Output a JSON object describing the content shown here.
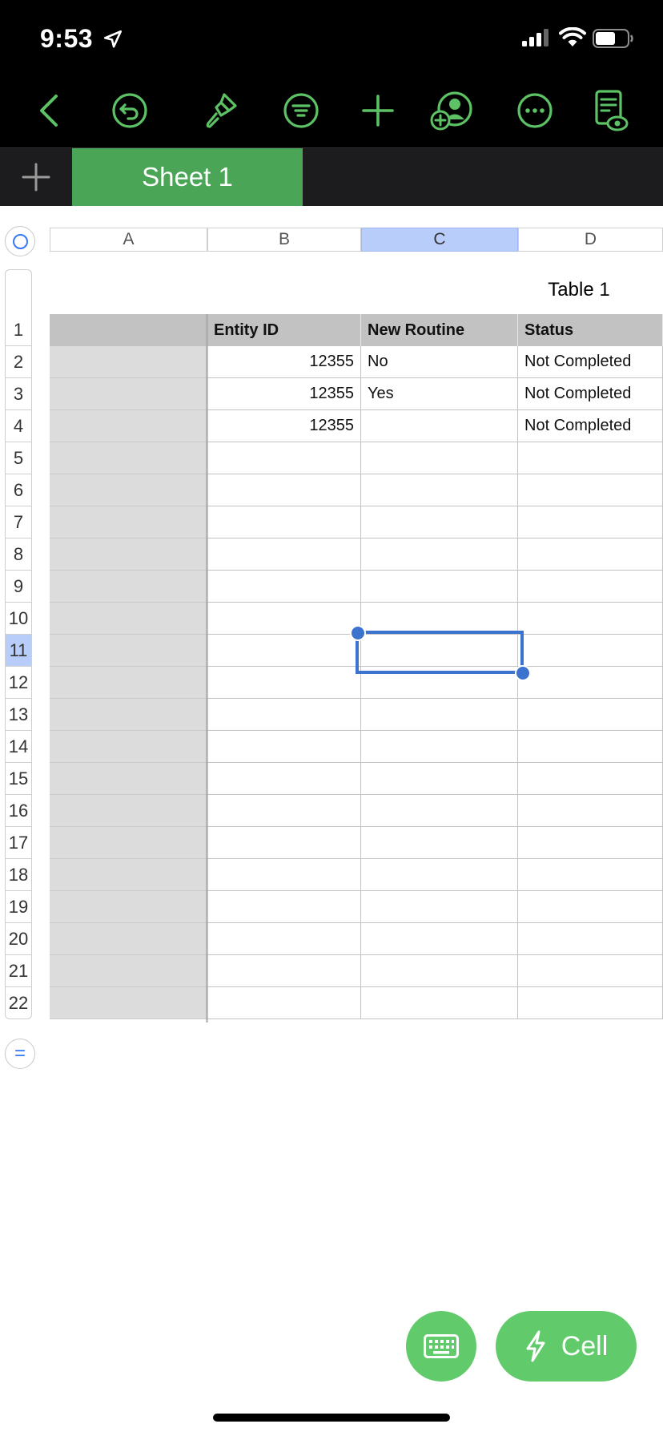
{
  "status_bar": {
    "time": "9:53"
  },
  "tab_bar": {
    "sheet_name": "Sheet 1"
  },
  "table": {
    "name": "Table 1",
    "columns": [
      "A",
      "B",
      "C",
      "D"
    ],
    "headers": [
      "",
      "Entity ID",
      "New Routine",
      "Status"
    ],
    "rows": [
      [
        "",
        "12355",
        "No",
        "Not Completed"
      ],
      [
        "",
        "12355",
        "Yes",
        "Not Completed"
      ],
      [
        "",
        "12355",
        "",
        "Not Completed"
      ]
    ],
    "row_numbers": [
      "1",
      "2",
      "3",
      "4",
      "5",
      "6",
      "7",
      "8",
      "9",
      "10",
      "11",
      "12",
      "13",
      "14",
      "15",
      "16",
      "17",
      "18",
      "19",
      "20",
      "21",
      "22"
    ],
    "selected_column": "C",
    "selected_row": "11"
  },
  "bottom": {
    "cell_button_label": "Cell"
  },
  "colors": {
    "accent_green": "#5dc265",
    "sheet_tab": "#4aa556",
    "selection_blue": "#3c73ce"
  }
}
